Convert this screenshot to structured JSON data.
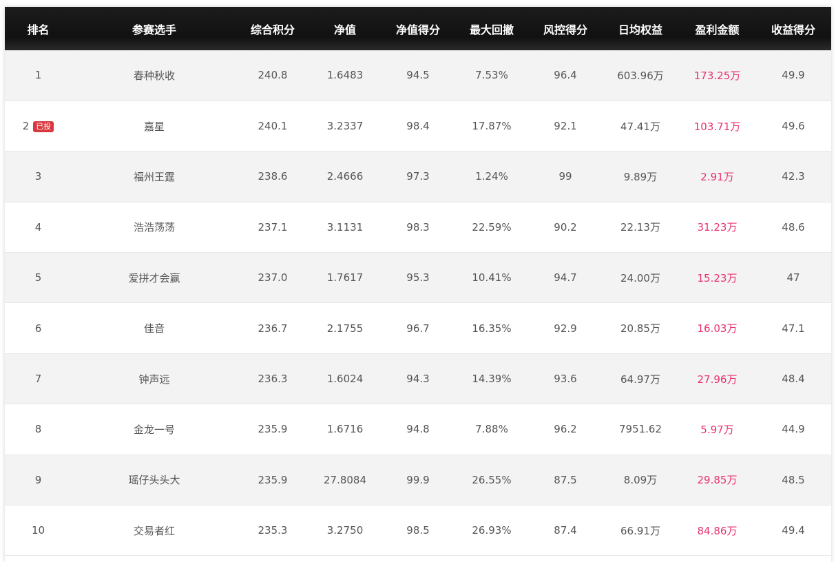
{
  "columns": [
    "排名",
    "参赛选手",
    "综合积分",
    "净值",
    "净值得分",
    "最大回撤",
    "风控得分",
    "日均权益",
    "盈利金额",
    "收益得分"
  ],
  "rows": [
    {
      "rank": "1",
      "name": "春种秋收",
      "score": "240.8",
      "nav": "1.6483",
      "nav_score": "94.5",
      "drawdown": "7.53%",
      "risk_score": "96.4",
      "equity": "603.96万",
      "profit": "173.25万",
      "return_score": "49.9",
      "badge": ""
    },
    {
      "rank": "2",
      "name": "嘉星",
      "score": "240.1",
      "nav": "3.2337",
      "nav_score": "98.4",
      "drawdown": "17.87%",
      "risk_score": "92.1",
      "equity": "47.41万",
      "profit": "103.71万",
      "return_score": "49.6",
      "badge": "已投"
    },
    {
      "rank": "3",
      "name": "福州王霆",
      "score": "238.6",
      "nav": "2.4666",
      "nav_score": "97.3",
      "drawdown": "1.24%",
      "risk_score": "99",
      "equity": "9.89万",
      "profit": "2.91万",
      "return_score": "42.3",
      "badge": ""
    },
    {
      "rank": "4",
      "name": "浩浩荡荡",
      "score": "237.1",
      "nav": "3.1131",
      "nav_score": "98.3",
      "drawdown": "22.59%",
      "risk_score": "90.2",
      "equity": "22.13万",
      "profit": "31.23万",
      "return_score": "48.6",
      "badge": ""
    },
    {
      "rank": "5",
      "name": "爱拼才会赢",
      "score": "237.0",
      "nav": "1.7617",
      "nav_score": "95.3",
      "drawdown": "10.41%",
      "risk_score": "94.7",
      "equity": "24.00万",
      "profit": "15.23万",
      "return_score": "47",
      "badge": ""
    },
    {
      "rank": "6",
      "name": "佳音",
      "score": "236.7",
      "nav": "2.1755",
      "nav_score": "96.7",
      "drawdown": "16.35%",
      "risk_score": "92.9",
      "equity": "20.85万",
      "profit": "16.03万",
      "return_score": "47.1",
      "badge": ""
    },
    {
      "rank": "7",
      "name": "钟声远",
      "score": "236.3",
      "nav": "1.6024",
      "nav_score": "94.3",
      "drawdown": "14.39%",
      "risk_score": "93.6",
      "equity": "64.97万",
      "profit": "27.96万",
      "return_score": "48.4",
      "badge": ""
    },
    {
      "rank": "8",
      "name": "金龙一号",
      "score": "235.9",
      "nav": "1.6716",
      "nav_score": "94.8",
      "drawdown": "7.88%",
      "risk_score": "96.2",
      "equity": "7951.62",
      "profit": "5.97万",
      "return_score": "44.9",
      "badge": ""
    },
    {
      "rank": "9",
      "name": "瑶仔头头大",
      "score": "235.9",
      "nav": "27.8084",
      "nav_score": "99.9",
      "drawdown": "26.55%",
      "risk_score": "87.5",
      "equity": "8.09万",
      "profit": "29.85万",
      "return_score": "48.5",
      "badge": ""
    },
    {
      "rank": "10",
      "name": "交易者红",
      "score": "235.3",
      "nav": "3.2750",
      "nav_score": "98.5",
      "drawdown": "26.93%",
      "risk_score": "87.4",
      "equity": "66.91万",
      "profit": "84.86万",
      "return_score": "49.4",
      "badge": ""
    }
  ],
  "colors": {
    "header_bg": "#111111",
    "profit_text": "#e8306e",
    "badge_bg": "#d9373e",
    "row_alt_bg": "#f3f3f3"
  }
}
